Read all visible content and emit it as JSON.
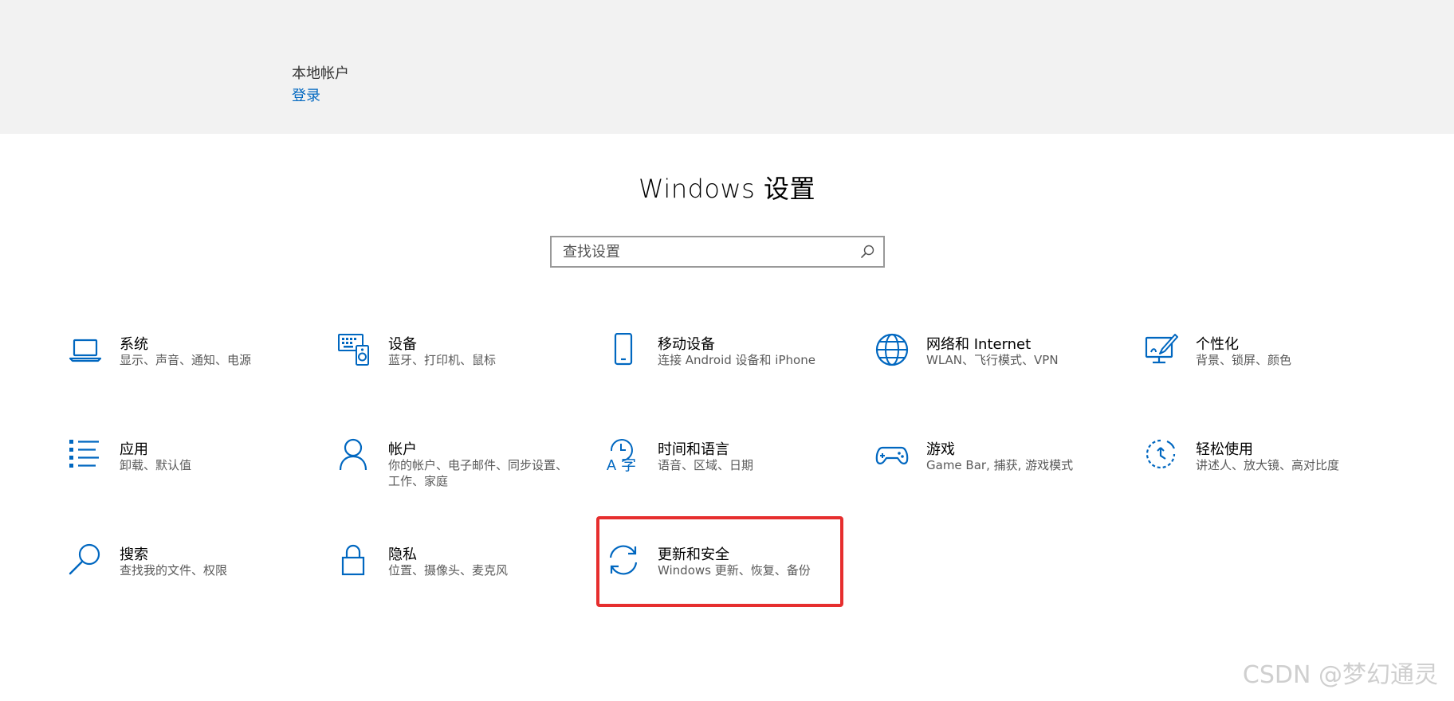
{
  "account": {
    "type": "本地帐户",
    "signin_label": "登录"
  },
  "title": "Windows 设置",
  "search": {
    "placeholder": "查找设置"
  },
  "categories": [
    {
      "title": "系统",
      "desc": "显示、声音、通知、电源",
      "icon": "laptop-icon"
    },
    {
      "title": "设备",
      "desc": "蓝牙、打印机、鼠标",
      "icon": "devices-icon"
    },
    {
      "title": "移动设备",
      "desc": "连接 Android 设备和 iPhone",
      "icon": "phone-icon"
    },
    {
      "title": "网络和 Internet",
      "desc": "WLAN、飞行模式、VPN",
      "icon": "globe-icon"
    },
    {
      "title": "个性化",
      "desc": "背景、锁屏、颜色",
      "icon": "personalization-icon"
    },
    {
      "title": "应用",
      "desc": "卸载、默认值",
      "icon": "apps-list-icon"
    },
    {
      "title": "帐户",
      "desc": "你的帐户、电子邮件、同步设置、工作、家庭",
      "icon": "person-icon"
    },
    {
      "title": "时间和语言",
      "desc": "语音、区域、日期",
      "icon": "time-language-icon"
    },
    {
      "title": "游戏",
      "desc": "Game Bar, 捕获, 游戏模式",
      "icon": "gamepad-icon"
    },
    {
      "title": "轻松使用",
      "desc": "讲述人、放大镜、高对比度",
      "icon": "ease-of-access-icon"
    },
    {
      "title": "搜索",
      "desc": "查找我的文件、权限",
      "icon": "search-icon"
    },
    {
      "title": "隐私",
      "desc": "位置、摄像头、麦克风",
      "icon": "lock-icon"
    },
    {
      "title": "更新和安全",
      "desc": "Windows 更新、恢复、备份",
      "icon": "sync-icon"
    }
  ],
  "watermark": "CSDN @梦幻通灵",
  "colors": {
    "accent": "#0067c0",
    "highlight": "#e62e2e",
    "header_bg": "#f2f2f2"
  }
}
